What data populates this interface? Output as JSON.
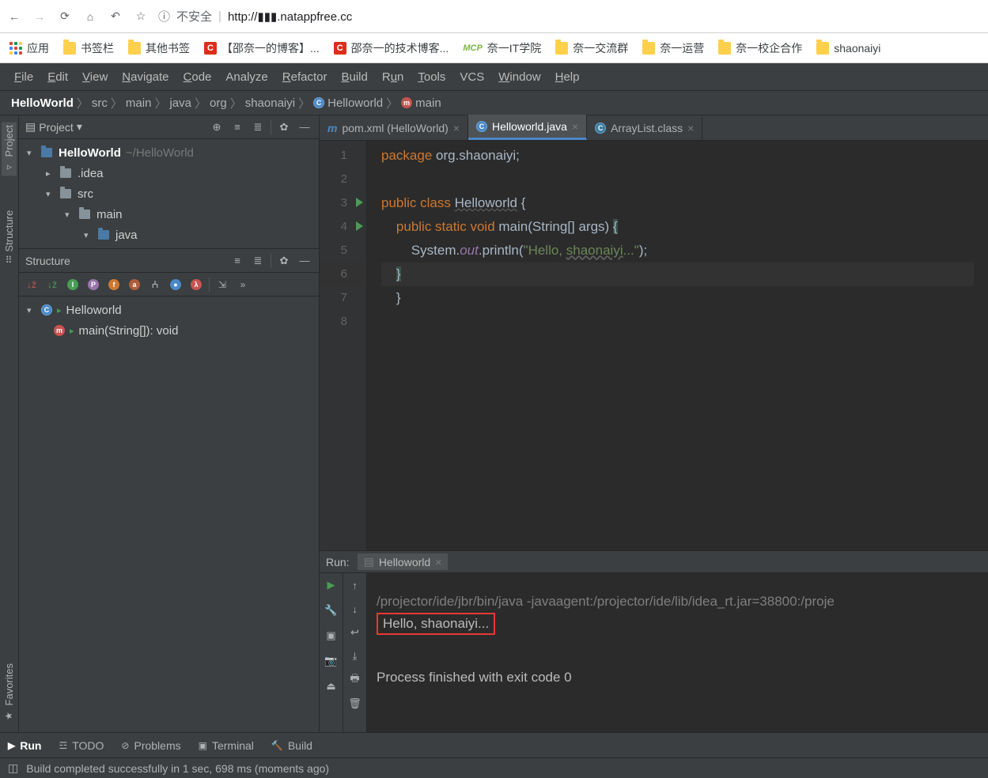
{
  "browser": {
    "insecure_label": "不安全",
    "url": "http://▮▮▮.natappfree.cc"
  },
  "bookmarks": {
    "apps": "应用",
    "items": [
      "书签栏",
      "其他书签",
      "【邵奈一的博客】...",
      "邵奈一的技术博客...",
      "奈一IT学院",
      "奈一交流群",
      "奈一运营",
      "奈一校企合作",
      "shaonaiyi"
    ]
  },
  "menu": [
    "File",
    "Edit",
    "View",
    "Navigate",
    "Code",
    "Analyze",
    "Refactor",
    "Build",
    "Run",
    "Tools",
    "VCS",
    "Window",
    "Help"
  ],
  "breadcrumb": {
    "items": [
      "HelloWorld",
      "src",
      "main",
      "java",
      "org",
      "shaonaiyi",
      "Helloworld",
      "main"
    ]
  },
  "project_panel": {
    "title": "Project",
    "root": {
      "name": "HelloWorld",
      "path": "~/HelloWorld"
    },
    "nodes": [
      ".idea",
      "src",
      "main",
      "java"
    ]
  },
  "structure_panel": {
    "title": "Structure",
    "class": "Helloworld",
    "method": "main(String[]): void"
  },
  "editor_tabs": [
    {
      "label": "pom.xml (HelloWorld)",
      "icon": "m"
    },
    {
      "label": "Helloworld.java",
      "icon": "c",
      "active": true
    },
    {
      "label": "ArrayList.class",
      "icon": "c"
    }
  ],
  "code": {
    "lines": [
      "package org.shaonaiyi;",
      "",
      "public class Helloworld {",
      "    public static void main(String[] args) {",
      "        System.out.println(\"Hello, shaonaiyi...\");",
      "    }",
      "}",
      ""
    ]
  },
  "run": {
    "label": "Run:",
    "tab": "Helloworld",
    "cmd": "/projector/ide/jbr/bin/java -javaagent:/projector/ide/lib/idea_rt.jar=38800:/proje",
    "output": "Hello, shaonaiyi...",
    "exit": "Process finished with exit code 0"
  },
  "left_tabs": {
    "project": "Project",
    "structure": "Structure",
    "favorites": "Favorites"
  },
  "bottom_tabs": {
    "run": "Run",
    "todo": "TODO",
    "problems": "Problems",
    "terminal": "Terminal",
    "build": "Build"
  },
  "status": "Build completed successfully in 1 sec, 698 ms (moments ago)"
}
